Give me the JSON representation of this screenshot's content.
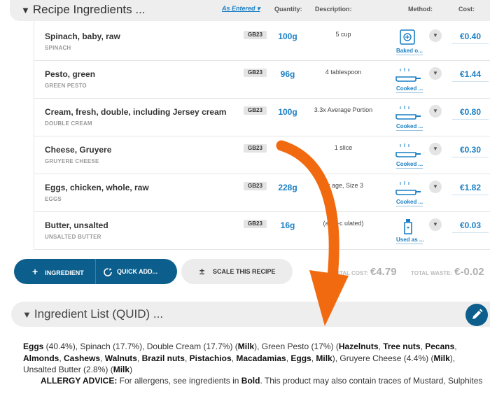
{
  "header": {
    "title": "Recipe Ingredients ...",
    "sort_label": "As Entered",
    "columns": {
      "quantity": "Quantity:",
      "description": "Description:",
      "method": "Method:",
      "cost": "Cost:"
    }
  },
  "ingredients": [
    {
      "name": "Spinach, baby, raw",
      "sub": "SPINACH",
      "code": "GB23",
      "qty": "100g",
      "desc": "5 cup",
      "method_icon": "oven-icon",
      "method": "Baked o...",
      "cost": "€0.40"
    },
    {
      "name": "Pesto, green",
      "sub": "GREEN PESTO",
      "code": "GB23",
      "qty": "96g",
      "desc": "4 tablespoon",
      "method_icon": "pan-icon",
      "method": "Cooked ...",
      "cost": "€1.44"
    },
    {
      "name": "Cream, fresh, double, including Jersey cream",
      "sub": "DOUBLE CREAM",
      "code": "GB23",
      "qty": "100g",
      "desc": "3.3x Average Portion",
      "method_icon": "pan-icon",
      "method": "Cooked ...",
      "cost": "€0.80"
    },
    {
      "name": "Cheese, Gruyere",
      "sub": "GRUYERE CHEESE",
      "code": "GB23",
      "qty": "",
      "desc": "1 slice",
      "method_icon": "pan-icon",
      "method": "Cooked ...",
      "cost": "€0.30"
    },
    {
      "name": "Eggs, chicken, whole, raw",
      "sub": "EGGS",
      "code": "GB23",
      "qty": "228g",
      "desc": "4x     age, Size 3",
      "method_icon": "pan-icon",
      "method": "Cooked ...",
      "cost": "€1.82"
    },
    {
      "name": "Butter, unsalted",
      "sub": "UNSALTED BUTTER",
      "code": "GB23",
      "qty": "16g",
      "desc": "(auto-c     ulated)",
      "method_icon": "bottle-icon",
      "method": "Used as ...",
      "cost": "€0.03"
    }
  ],
  "actions": {
    "add_ingredient": "INGREDIENT",
    "quick_add": "QUICK ADD...",
    "scale": "SCALE THIS RECIPE"
  },
  "totals": {
    "cost_label": "TOTAL COST:",
    "cost_value": "€4.79",
    "waste_label": "TOTAL WASTE:",
    "waste_value": "€-0.02"
  },
  "quid": {
    "title": "Ingredient List (QUID) ...",
    "segments": [
      {
        "t": "Eggs",
        "b": true
      },
      {
        "t": " (40.4%), Spinach (17.7%), Double Cream (17.7%) (",
        "b": false
      },
      {
        "t": "Milk",
        "b": true
      },
      {
        "t": "), Green Pesto (17%) (",
        "b": false
      },
      {
        "t": "Hazelnuts",
        "b": true
      },
      {
        "t": ", ",
        "b": false
      },
      {
        "t": "Tree nuts",
        "b": true
      },
      {
        "t": ", ",
        "b": false
      },
      {
        "t": "Pecans",
        "b": true
      },
      {
        "t": ", ",
        "b": false
      },
      {
        "t": "Almonds",
        "b": true
      },
      {
        "t": ", ",
        "b": false
      },
      {
        "t": "Cashews",
        "b": true
      },
      {
        "t": ", ",
        "b": false
      },
      {
        "t": "Walnuts",
        "b": true
      },
      {
        "t": ", ",
        "b": false
      },
      {
        "t": "Brazil nuts",
        "b": true
      },
      {
        "t": ", ",
        "b": false
      },
      {
        "t": "Pistachios",
        "b": true
      },
      {
        "t": ", ",
        "b": false
      },
      {
        "t": "Macadamias",
        "b": true
      },
      {
        "t": ", ",
        "b": false
      },
      {
        "t": "Eggs",
        "b": true
      },
      {
        "t": ", ",
        "b": false
      },
      {
        "t": "Milk",
        "b": true
      },
      {
        "t": "), Gruyere Cheese (4.4%) (",
        "b": false
      },
      {
        "t": "Milk",
        "b": true
      },
      {
        "t": "), Unsalted Butter (2.8%) (",
        "b": false
      },
      {
        "t": "Milk",
        "b": true
      },
      {
        "t": ")",
        "b": false
      }
    ],
    "allergy_label": "ALLERGY ADVICE:",
    "allergy_pre": " For allergens, see ingredients in ",
    "allergy_bold": "Bold",
    "allergy_post": ". This product may also contain traces of Mustard, Sulphites"
  },
  "colors": {
    "accent": "#1a7fc4",
    "primary_button": "#0c5f8c",
    "annotation_arrow": "#f26a10"
  }
}
